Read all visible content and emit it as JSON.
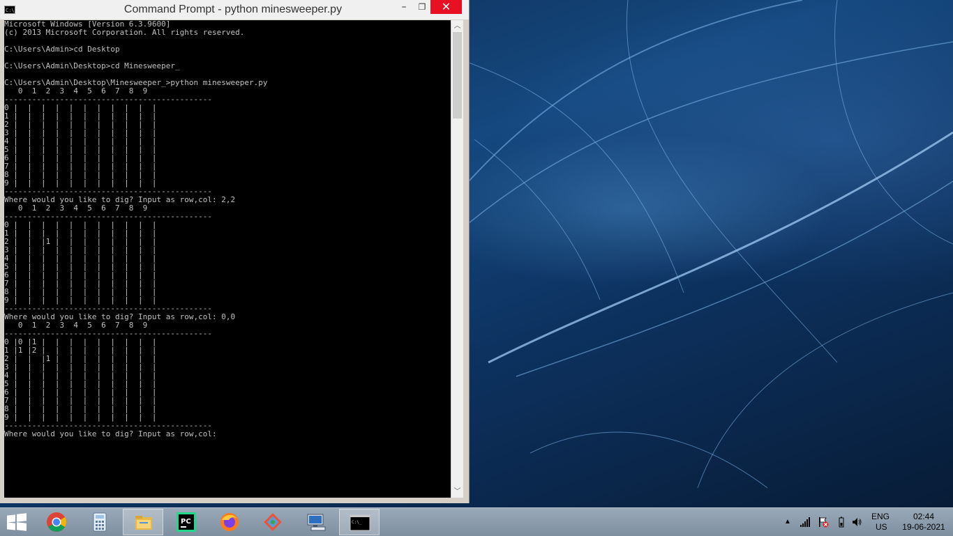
{
  "window": {
    "title": "Command Prompt - python  minesweeper.py",
    "minimize": "–",
    "maximize": "❐",
    "close": "✕"
  },
  "console_lines": [
    "Microsoft Windows [Version 6.3.9600]",
    "(c) 2013 Microsoft Corporation. All rights reserved.",
    "",
    "C:\\Users\\Admin>cd Desktop",
    "",
    "C:\\Users\\Admin\\Desktop>cd Minesweeper_",
    "",
    "C:\\Users\\Admin\\Desktop\\Minesweeper_>python minesweeper.py",
    "   0  1  2  3  4  5  6  7  8  9",
    "---------------------------------------------",
    "0 |  |  |  |  |  |  |  |  |  |  |",
    "1 |  |  |  |  |  |  |  |  |  |  |",
    "2 |  |  |  |  |  |  |  |  |  |  |",
    "3 |  |  |  |  |  |  |  |  |  |  |",
    "4 |  |  |  |  |  |  |  |  |  |  |",
    "5 |  |  |  |  |  |  |  |  |  |  |",
    "6 |  |  |  |  |  |  |  |  |  |  |",
    "7 |  |  |  |  |  |  |  |  |  |  |",
    "8 |  |  |  |  |  |  |  |  |  |  |",
    "9 |  |  |  |  |  |  |  |  |  |  |",
    "---------------------------------------------",
    "Where would you like to dig? Input as row,col: 2,2",
    "   0  1  2  3  4  5  6  7  8  9",
    "---------------------------------------------",
    "0 |  |  |  |  |  |  |  |  |  |  |",
    "1 |  |  |  |  |  |  |  |  |  |  |",
    "2 |  |  |1 |  |  |  |  |  |  |  |",
    "3 |  |  |  |  |  |  |  |  |  |  |",
    "4 |  |  |  |  |  |  |  |  |  |  |",
    "5 |  |  |  |  |  |  |  |  |  |  |",
    "6 |  |  |  |  |  |  |  |  |  |  |",
    "7 |  |  |  |  |  |  |  |  |  |  |",
    "8 |  |  |  |  |  |  |  |  |  |  |",
    "9 |  |  |  |  |  |  |  |  |  |  |",
    "---------------------------------------------",
    "Where would you like to dig? Input as row,col: 0,0",
    "   0  1  2  3  4  5  6  7  8  9",
    "---------------------------------------------",
    "0 |0 |1 |  |  |  |  |  |  |  |  |",
    "1 |1 |2 |  |  |  |  |  |  |  |  |",
    "2 |  |  |1 |  |  |  |  |  |  |  |",
    "3 |  |  |  |  |  |  |  |  |  |  |",
    "4 |  |  |  |  |  |  |  |  |  |  |",
    "5 |  |  |  |  |  |  |  |  |  |  |",
    "6 |  |  |  |  |  |  |  |  |  |  |",
    "7 |  |  |  |  |  |  |  |  |  |  |",
    "8 |  |  |  |  |  |  |  |  |  |  |",
    "9 |  |  |  |  |  |  |  |  |  |  |",
    "---------------------------------------------",
    "Where would you like to dig? Input as row,col:"
  ],
  "taskbar": {
    "pinned": [
      {
        "name": "chrome-icon"
      },
      {
        "name": "calculator-icon"
      },
      {
        "name": "file-explorer-icon"
      },
      {
        "name": "pycharm-icon",
        "label": "PC"
      },
      {
        "name": "firefox-icon"
      },
      {
        "name": "git-icon"
      },
      {
        "name": "remote-desktop-icon"
      },
      {
        "name": "command-prompt-icon",
        "label": "C:\\_"
      }
    ]
  },
  "tray": {
    "lang_top": "ENG",
    "lang_bottom": "US",
    "time": "02:44",
    "date": "19-06-2021"
  },
  "colors": {
    "console_bg": "#000000",
    "console_text": "#c0c0c0",
    "close_red": "#e81123"
  }
}
